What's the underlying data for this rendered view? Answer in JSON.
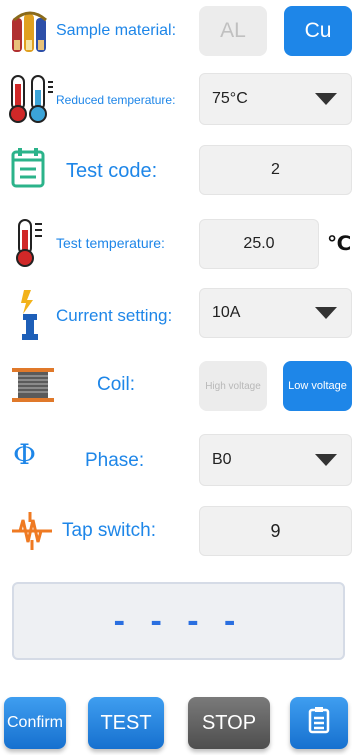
{
  "sample_material": {
    "label": "Sample material:",
    "options": [
      "AL",
      "Cu"
    ],
    "selected": "Cu"
  },
  "reduced_temperature": {
    "label": "Reduced temperature:",
    "value": "75°C"
  },
  "test_code": {
    "label": "Test code:",
    "value": "2"
  },
  "test_temperature": {
    "label": "Test temperature:",
    "value": "25.0",
    "unit": "℃"
  },
  "current_setting": {
    "label": "Current setting:",
    "value": "10A"
  },
  "coil": {
    "label": "Coil:",
    "options": [
      "High voltage",
      "Low voltage"
    ],
    "selected": "Low voltage"
  },
  "phase": {
    "label": "Phase:",
    "symbol": "Φ",
    "value": "B0"
  },
  "tap_switch": {
    "label": "Tap switch:",
    "value": "9"
  },
  "result_display": {
    "value": "- - - -"
  },
  "buttons": {
    "confirm": "Confirm",
    "test": "TEST",
    "stop": "STOP"
  },
  "colors": {
    "accent": "#1e86e8",
    "field_bg": "#f1f1f1",
    "stop_bg": "#5a5a5a"
  }
}
